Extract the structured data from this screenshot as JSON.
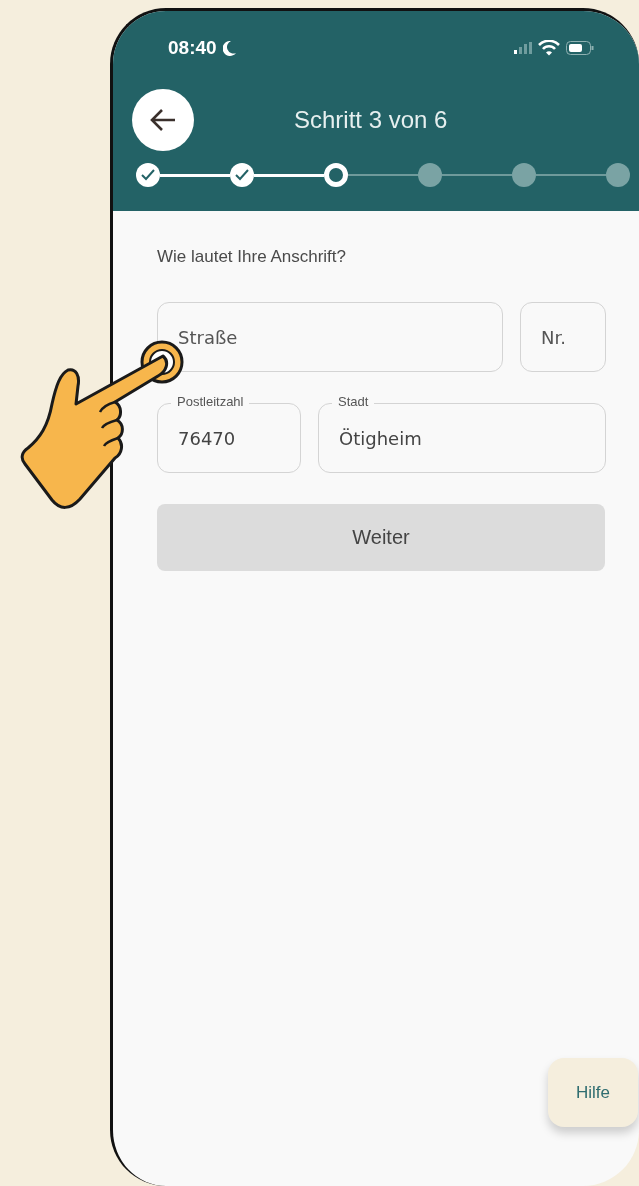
{
  "status_bar": {
    "time": "08:40"
  },
  "header": {
    "title": "Schritt 3 von 6"
  },
  "steps": [
    {
      "done": true,
      "current": false
    },
    {
      "done": true,
      "current": false
    },
    {
      "done": false,
      "current": true
    },
    {
      "done": false,
      "current": false
    },
    {
      "done": false,
      "current": false
    },
    {
      "done": false,
      "current": false
    }
  ],
  "question": "Wie lautet Ihre Anschrift?",
  "field_rows": [
    [
      {
        "kind": "wide",
        "placeholder": "Straße"
      },
      {
        "kind": "narrow",
        "placeholder": "Nr."
      }
    ],
    [
      {
        "kind": "narrow",
        "label": "Postleitzahl",
        "value": "76470"
      },
      {
        "kind": "wide",
        "label": "Stadt",
        "value": "Ötigheim"
      }
    ]
  ],
  "continue_button": {
    "label": "Weiter",
    "disabled": true
  },
  "help_button": {
    "label": "Hilfe"
  }
}
